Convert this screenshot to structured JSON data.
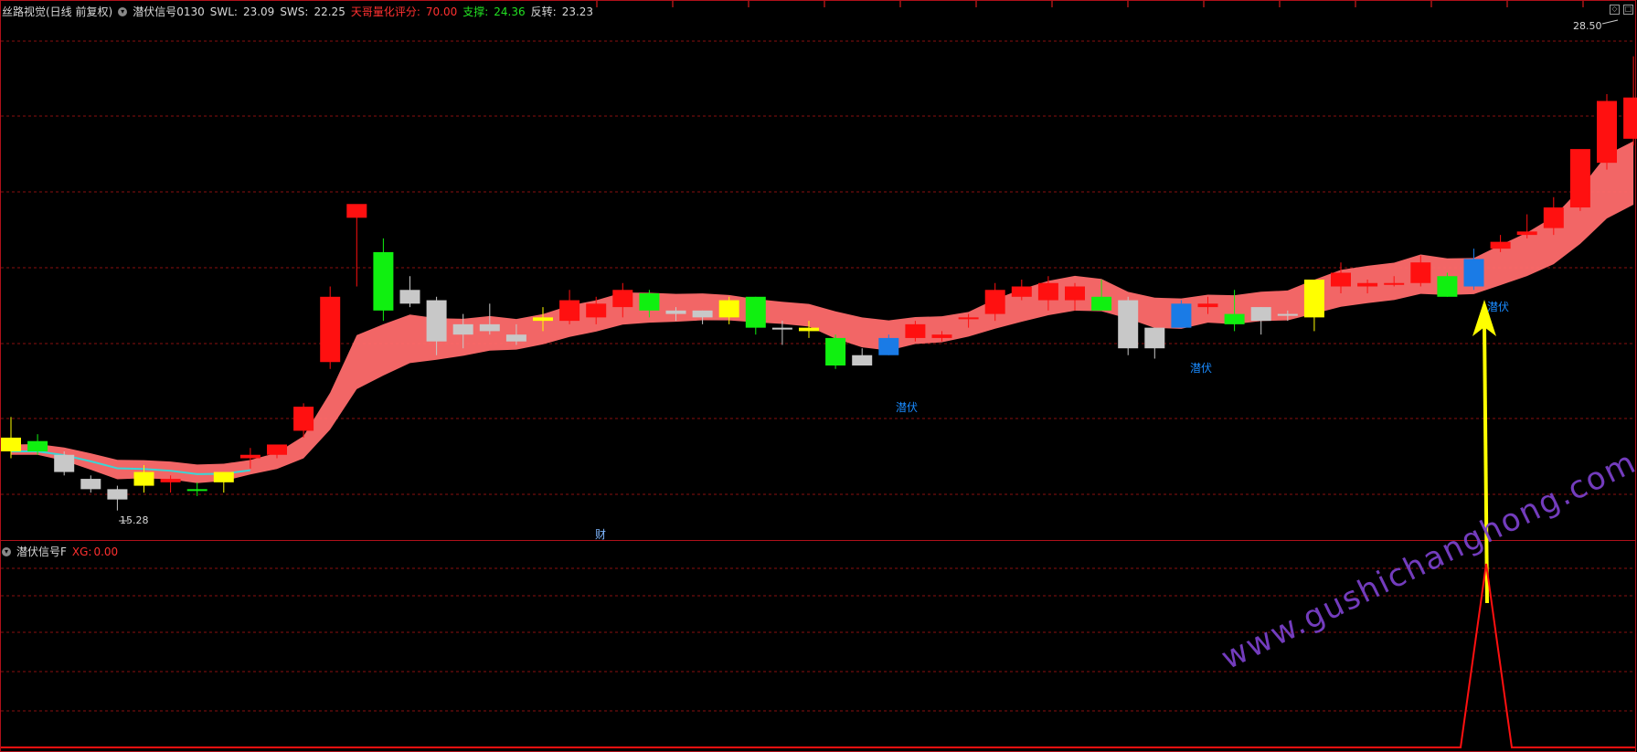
{
  "header": {
    "title": "丝路视觉(日线 前复权)",
    "indicator": "潜伏信号0130",
    "swl_label": "SWL:",
    "swl_value": "23.09",
    "sws_label": "SWS:",
    "sws_value": "22.25",
    "score_label": "天哥量化评分:",
    "score_value": "70.00",
    "support_label": "支撑:",
    "support_value": "24.36",
    "reversal_label": "反转:",
    "reversal_value": "23.23"
  },
  "sub_header": {
    "title": "潜伏信号F",
    "xg_label": "XG:",
    "xg_value": "0.00"
  },
  "annotations": {
    "high_price": "28.50",
    "low_price": "15.28",
    "signal_1": "潜伏",
    "signal_2": "潜伏",
    "signal_3": "潜伏",
    "cai": "财"
  },
  "watermark": "www.gushichanghong.com",
  "colors": {
    "up": "#ff1010",
    "down": "#10f010",
    "doji_grey": "#c8c8c8",
    "yellow": "#ffff00",
    "blue": "#1a7be6",
    "band": "#ff6b6b",
    "grid": "#8a0f0f",
    "signal_line": "#ff1010",
    "arrow": "#ffff00"
  },
  "chart_data": {
    "type": "candlestick",
    "price_range": [
      14.5,
      29.5
    ],
    "candles": [
      {
        "o": 17.4,
        "h": 18.0,
        "l": 16.8,
        "c": 17.0,
        "color": "yellow"
      },
      {
        "o": 17.3,
        "h": 17.5,
        "l": 16.9,
        "c": 17.0,
        "color": "green"
      },
      {
        "o": 16.9,
        "h": 17.0,
        "l": 16.3,
        "c": 16.4,
        "color": "grey"
      },
      {
        "o": 16.2,
        "h": 16.3,
        "l": 15.8,
        "c": 15.9,
        "color": "grey"
      },
      {
        "o": 15.9,
        "h": 16.0,
        "l": 15.28,
        "c": 15.6,
        "color": "grey"
      },
      {
        "o": 16.0,
        "h": 16.6,
        "l": 15.8,
        "c": 16.4,
        "color": "yellow"
      },
      {
        "o": 16.1,
        "h": 16.3,
        "l": 15.8,
        "c": 16.2,
        "color": "red"
      },
      {
        "o": 15.9,
        "h": 16.1,
        "l": 15.7,
        "c": 15.9,
        "color": "green"
      },
      {
        "o": 16.1,
        "h": 16.4,
        "l": 15.8,
        "c": 16.4,
        "color": "yellow"
      },
      {
        "o": 16.8,
        "h": 17.1,
        "l": 16.5,
        "c": 16.9,
        "color": "red"
      },
      {
        "o": 16.9,
        "h": 17.2,
        "l": 16.8,
        "c": 17.2,
        "color": "red"
      },
      {
        "o": 17.6,
        "h": 18.4,
        "l": 17.4,
        "c": 18.3,
        "color": "red"
      },
      {
        "o": 19.6,
        "h": 21.8,
        "l": 19.4,
        "c": 21.5,
        "color": "red"
      },
      {
        "o": 23.8,
        "h": 24.1,
        "l": 21.8,
        "c": 24.2,
        "color": "red"
      },
      {
        "o": 22.8,
        "h": 23.2,
        "l": 20.8,
        "c": 21.1,
        "color": "green"
      },
      {
        "o": 21.7,
        "h": 22.1,
        "l": 21.2,
        "c": 21.3,
        "color": "grey"
      },
      {
        "o": 21.4,
        "h": 21.5,
        "l": 19.8,
        "c": 20.2,
        "color": "grey"
      },
      {
        "o": 20.7,
        "h": 21.0,
        "l": 20.0,
        "c": 20.4,
        "color": "grey"
      },
      {
        "o": 20.5,
        "h": 21.3,
        "l": 20.4,
        "c": 20.7,
        "color": "grey"
      },
      {
        "o": 20.4,
        "h": 20.7,
        "l": 20.1,
        "c": 20.2,
        "color": "grey"
      },
      {
        "o": 20.8,
        "h": 21.2,
        "l": 20.5,
        "c": 20.9,
        "color": "yellow"
      },
      {
        "o": 20.8,
        "h": 21.7,
        "l": 20.7,
        "c": 21.4,
        "color": "red"
      },
      {
        "o": 20.9,
        "h": 21.5,
        "l": 20.7,
        "c": 21.3,
        "color": "red"
      },
      {
        "o": 21.2,
        "h": 21.9,
        "l": 20.9,
        "c": 21.7,
        "color": "red"
      },
      {
        "o": 21.6,
        "h": 21.7,
        "l": 20.9,
        "c": 21.1,
        "color": "green"
      },
      {
        "o": 21.1,
        "h": 21.2,
        "l": 20.8,
        "c": 21.0,
        "color": "grey"
      },
      {
        "o": 20.9,
        "h": 21.1,
        "l": 20.7,
        "c": 21.1,
        "color": "grey"
      },
      {
        "o": 21.4,
        "h": 21.5,
        "l": 20.7,
        "c": 20.9,
        "color": "yellow"
      },
      {
        "o": 21.5,
        "h": 21.5,
        "l": 20.4,
        "c": 20.6,
        "color": "green"
      },
      {
        "o": 20.6,
        "h": 20.8,
        "l": 20.1,
        "c": 20.6,
        "color": "grey"
      },
      {
        "o": 20.6,
        "h": 20.8,
        "l": 20.3,
        "c": 20.5,
        "color": "yellow"
      },
      {
        "o": 20.3,
        "h": 20.4,
        "l": 19.4,
        "c": 19.5,
        "color": "green"
      },
      {
        "o": 19.8,
        "h": 20.0,
        "l": 19.5,
        "c": 19.5,
        "color": "grey"
      },
      {
        "o": 20.3,
        "h": 20.4,
        "l": 19.8,
        "c": 19.8,
        "color": "blue"
      },
      {
        "o": 20.3,
        "h": 20.8,
        "l": 20.2,
        "c": 20.7,
        "color": "red"
      },
      {
        "o": 20.3,
        "h": 20.5,
        "l": 20.2,
        "c": 20.4,
        "color": "red"
      },
      {
        "o": 20.9,
        "h": 21.0,
        "l": 20.6,
        "c": 20.9,
        "color": "red"
      },
      {
        "o": 21.0,
        "h": 21.9,
        "l": 20.8,
        "c": 21.7,
        "color": "red"
      },
      {
        "o": 21.5,
        "h": 22.0,
        "l": 21.4,
        "c": 21.8,
        "color": "red"
      },
      {
        "o": 21.4,
        "h": 22.1,
        "l": 21.1,
        "c": 21.9,
        "color": "red"
      },
      {
        "o": 21.4,
        "h": 21.9,
        "l": 21.1,
        "c": 21.8,
        "color": "red"
      },
      {
        "o": 21.5,
        "h": 22.0,
        "l": 21.4,
        "c": 21.1,
        "color": "green"
      },
      {
        "o": 21.4,
        "h": 21.5,
        "l": 19.8,
        "c": 20.0,
        "color": "grey"
      },
      {
        "o": 20.6,
        "h": 20.6,
        "l": 19.7,
        "c": 20.0,
        "color": "grey"
      },
      {
        "o": 21.3,
        "h": 21.4,
        "l": 20.6,
        "c": 20.6,
        "color": "blue"
      },
      {
        "o": 21.2,
        "h": 21.5,
        "l": 21.0,
        "c": 21.3,
        "color": "red"
      },
      {
        "o": 21.0,
        "h": 21.7,
        "l": 20.5,
        "c": 20.7,
        "color": "green"
      },
      {
        "o": 20.8,
        "h": 21.2,
        "l": 20.4,
        "c": 21.2,
        "color": "grey"
      },
      {
        "o": 21.0,
        "h": 21.1,
        "l": 20.8,
        "c": 21.0,
        "color": "grey"
      },
      {
        "o": 20.9,
        "h": 22.0,
        "l": 20.5,
        "c": 22.0,
        "color": "yellow"
      },
      {
        "o": 21.8,
        "h": 22.5,
        "l": 21.6,
        "c": 22.2,
        "color": "red"
      },
      {
        "o": 21.8,
        "h": 22.0,
        "l": 21.6,
        "c": 21.9,
        "color": "red"
      },
      {
        "o": 21.9,
        "h": 22.1,
        "l": 21.8,
        "c": 21.9,
        "color": "red"
      },
      {
        "o": 21.9,
        "h": 22.7,
        "l": 21.8,
        "c": 22.5,
        "color": "red"
      },
      {
        "o": 22.1,
        "h": 22.2,
        "l": 21.5,
        "c": 21.5,
        "color": "green"
      },
      {
        "o": 22.6,
        "h": 22.9,
        "l": 21.7,
        "c": 21.8,
        "color": "blue"
      },
      {
        "o": 22.9,
        "h": 23.3,
        "l": 22.8,
        "c": 23.1,
        "color": "red"
      },
      {
        "o": 23.3,
        "h": 23.9,
        "l": 23.2,
        "c": 23.4,
        "color": "red"
      },
      {
        "o": 23.5,
        "h": 24.4,
        "l": 23.3,
        "c": 24.1,
        "color": "red"
      },
      {
        "o": 24.1,
        "h": 25.6,
        "l": 24.0,
        "c": 25.8,
        "color": "red"
      },
      {
        "o": 25.4,
        "h": 27.4,
        "l": 25.2,
        "c": 27.2,
        "color": "red"
      },
      {
        "o": 27.3,
        "h": 28.5,
        "l": 25.9,
        "c": 26.1,
        "color": "red"
      }
    ]
  }
}
